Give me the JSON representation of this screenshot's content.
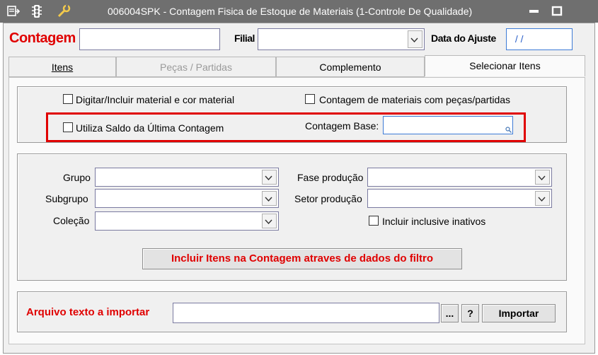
{
  "window": {
    "title": "006004SPK - Contagem Fisica de Estoque de Materiais (1-Controle De Qualidade)",
    "icons": [
      "menu-icon",
      "traffic-light-icon",
      "wrench-icon"
    ],
    "controls": [
      "minimize-icon",
      "maximize-icon"
    ]
  },
  "header": {
    "contagem_label": "Contagem",
    "contagem_value": "",
    "filial_label": "Filial",
    "filial_value": "",
    "data_ajuste_label": "Data do Ajuste",
    "data_ajuste_value": " / /"
  },
  "tabs": [
    {
      "label": "Itens",
      "state": "normal"
    },
    {
      "label": "Peças / Partidas",
      "state": "disabled"
    },
    {
      "label": "Complemento",
      "state": "normal"
    },
    {
      "label": "Selecionar Itens",
      "state": "active"
    }
  ],
  "options": {
    "digitar_label": "Digitar/Incluir material e cor material",
    "contagem_pecas_label": "Contagem de materiais com peças/partidas",
    "utiliza_saldo_label": "Utiliza Saldo da Última Contagem",
    "contagem_base_label": "Contagem Base:",
    "contagem_base_value": ""
  },
  "filters": {
    "grupo_label": "Grupo",
    "subgrupo_label": "Subgrupo",
    "colecao_label": "Coleção",
    "fase_label": "Fase produção",
    "setor_label": "Setor produção",
    "inativos_label": "Incluir inclusive inativos",
    "incluir_button": "Incluir Itens na Contagem atraves de dados do filtro"
  },
  "import": {
    "label": "Arquivo texto a importar",
    "value": "",
    "browse_button": "...",
    "help_button": "?",
    "import_button": "Importar"
  },
  "colors": {
    "accent_red": "#e00000",
    "titlebar": "#6f6f6f",
    "input_border_blue": "#3d7bd6"
  }
}
